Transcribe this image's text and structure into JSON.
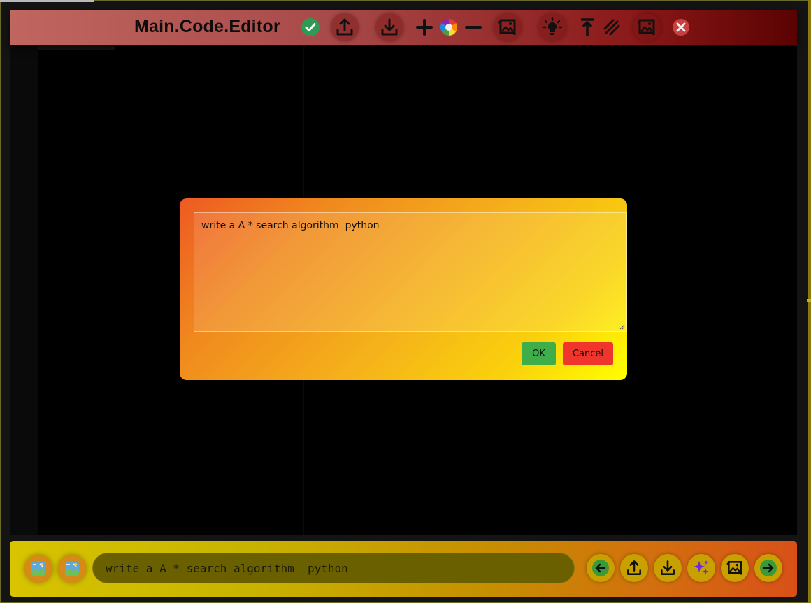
{
  "app": {
    "title": "Main.Code.Editor"
  },
  "toolbar": {
    "buttons": [
      {
        "name": "check-icon",
        "label": "Run"
      },
      {
        "name": "upload-icon",
        "label": "Upload"
      },
      {
        "name": "download-icon",
        "label": "Download"
      },
      {
        "name": "plus-icon",
        "label": "Zoom in"
      },
      {
        "name": "color-wheel-icon",
        "label": "Theme"
      },
      {
        "name": "minus-icon",
        "label": "Zoom out"
      },
      {
        "name": "image-crop-icon",
        "label": "Image"
      },
      {
        "name": "lightbulb-icon",
        "label": "Hint"
      },
      {
        "name": "arrow-up-bar-icon",
        "label": "Top"
      },
      {
        "name": "slashes-icon",
        "label": "Comment"
      },
      {
        "name": "image-crop-icon",
        "label": "Image"
      },
      {
        "name": "close-icon",
        "label": "Close"
      }
    ]
  },
  "dialog": {
    "prompt_value": "write a A * search algorithm  python",
    "ok_label": "OK",
    "cancel_label": "Cancel"
  },
  "bottombar": {
    "command_value": "write a A * search algorithm  python",
    "buttons": [
      "map-icon",
      "map-icon",
      "arrow-left-icon",
      "upload-icon",
      "download-icon",
      "sparkle-icon",
      "image-crop-icon",
      "arrow-right-icon"
    ]
  },
  "colors": {
    "toolbar_start": "#c0665f",
    "toolbar_end": "#5a0202",
    "dialog_start": "#ee5a22",
    "dialog_end": "#ffff00",
    "ok": "#3fae4a",
    "cancel": "#f0352d",
    "bottom_start": "#d8c400",
    "bottom_end": "#d85018"
  }
}
